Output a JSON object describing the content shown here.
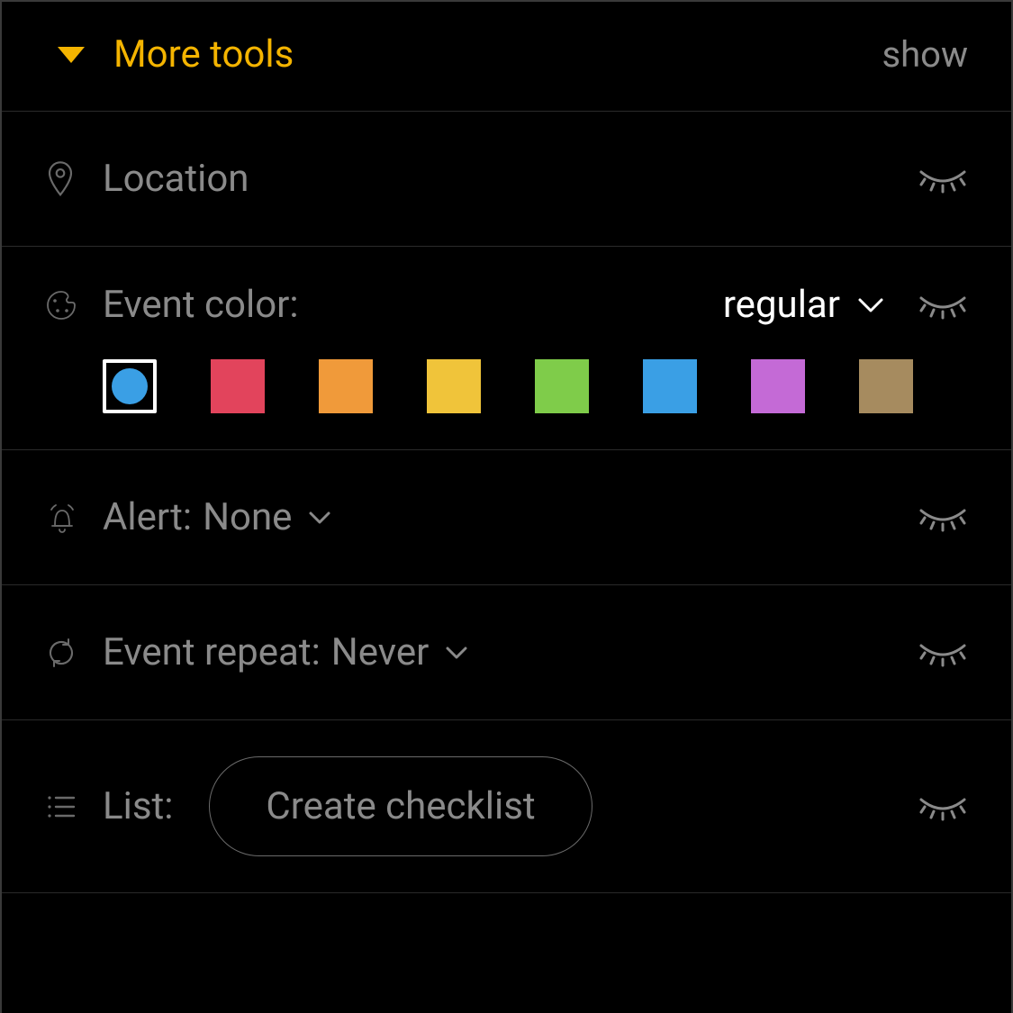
{
  "header": {
    "title": "More tools",
    "show": "show"
  },
  "location": {
    "placeholder": "Location"
  },
  "eventColor": {
    "label": "Event color:",
    "mode": "regular",
    "swatches": [
      {
        "hex": "#3a9fe5",
        "selected": true
      },
      {
        "hex": "#e2445c",
        "selected": false
      },
      {
        "hex": "#f09a3a",
        "selected": false
      },
      {
        "hex": "#f0c43a",
        "selected": false
      },
      {
        "hex": "#7fcc4a",
        "selected": false
      },
      {
        "hex": "#3a9fe5",
        "selected": false
      },
      {
        "hex": "#c46ad6",
        "selected": false
      },
      {
        "hex": "#a68b5f",
        "selected": false
      }
    ]
  },
  "alert": {
    "label": "Alert:",
    "value": "None"
  },
  "repeat": {
    "label": "Event repeat:",
    "value": "Never"
  },
  "list": {
    "label": "List:",
    "button": "Create checklist"
  }
}
